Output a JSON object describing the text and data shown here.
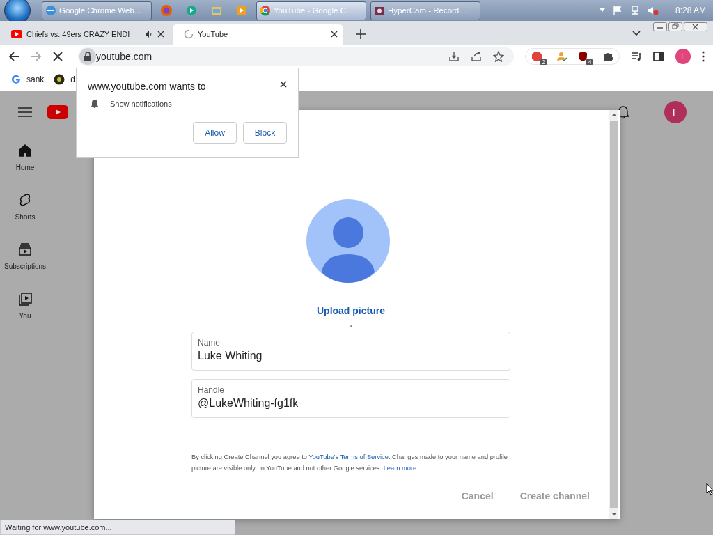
{
  "taskbar": {
    "windows": [
      {
        "label": "Google Chrome Web...",
        "selected": false
      },
      {
        "label": "YouTube - Google C...",
        "selected": true
      },
      {
        "label": "HyperCam - Recordi...",
        "selected": false
      }
    ],
    "clock": "8:28 AM"
  },
  "tabs": [
    {
      "title": "Chiefs vs. 49ers CRAZY ENDI",
      "selected": false,
      "loading": false,
      "audio": true
    },
    {
      "title": "YouTube",
      "selected": true,
      "loading": true,
      "audio": false
    }
  ],
  "toolbar": {
    "address": "youtube.com",
    "extension_badges": [
      "2",
      "4"
    ],
    "profile": "L"
  },
  "bookmarks": [
    "sank",
    "d"
  ],
  "permission_popup": {
    "title": "www.youtube.com wants to",
    "permission": "Show notifications",
    "buttons": [
      "Allow",
      "Block"
    ]
  },
  "youtube": {
    "sidebar": [
      {
        "label": "Home",
        "selected": true
      },
      {
        "label": "Shorts",
        "selected": false
      },
      {
        "label": "Subscriptions",
        "selected": false
      },
      {
        "label": "You",
        "selected": false
      }
    ],
    "avatar": "L"
  },
  "dialog": {
    "upload_link": "Upload picture",
    "fields": [
      {
        "label": "Name",
        "value": "Luke Whiting"
      },
      {
        "label": "Handle",
        "value": "@LukeWhiting-fg1fk"
      }
    ],
    "legal": [
      {
        "kind": "text",
        "text": "By clicking Create Channel you agree to "
      },
      {
        "kind": "link",
        "text": "YouTube's Terms of Service"
      },
      {
        "kind": "text",
        "text": ". Changes made to your name and profile picture are visible only on YouTube and not other Google services. "
      },
      {
        "kind": "link",
        "text": "Learn more"
      }
    ],
    "buttons": [
      {
        "label": "Cancel",
        "disabled": true
      },
      {
        "label": "Create channel",
        "disabled": true
      }
    ]
  },
  "status_bar": "Waiting for www.youtube.com..."
}
